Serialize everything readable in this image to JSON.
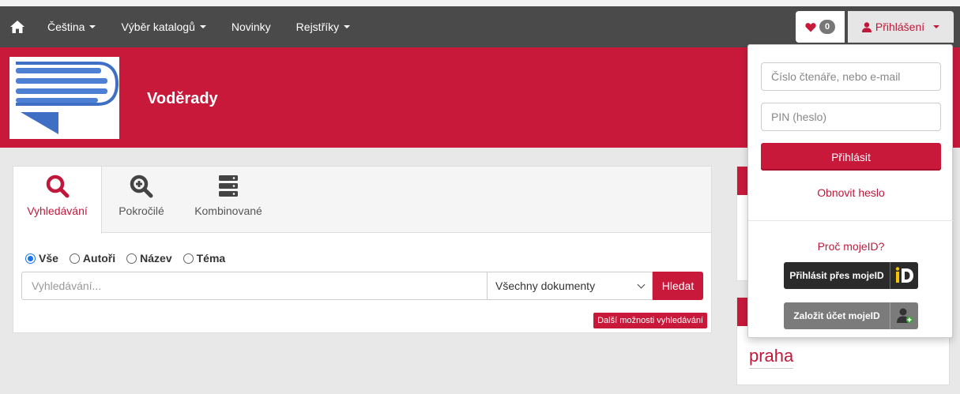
{
  "navbar": {
    "items": [
      {
        "label": "Čeština",
        "dropdown": true
      },
      {
        "label": "Výběr katalogů",
        "dropdown": true
      },
      {
        "label": "Novinky",
        "dropdown": false
      },
      {
        "label": "Rejstříky",
        "dropdown": true
      }
    ],
    "favorites_count": "0",
    "login_label": "Přihlášení"
  },
  "header": {
    "title": "Voděrady"
  },
  "search": {
    "tabs": [
      {
        "label": "Vyhledávání",
        "icon": "search-icon"
      },
      {
        "label": "Pokročilé",
        "icon": "zoom-in-icon"
      },
      {
        "label": "Kombinované",
        "icon": "server-stack-icon"
      }
    ],
    "radios": [
      "Vše",
      "Autoři",
      "Název",
      "Téma"
    ],
    "selected_radio": "Vše",
    "input_placeholder": "Vyhledávání...",
    "doc_type_selected": "Všechny dokumenty",
    "search_button": "Hledat",
    "more_options": "Další možnosti vyhledávání"
  },
  "side": {
    "tag_word": "praha"
  },
  "login_dropdown": {
    "reader_placeholder": "Číslo čtenáře, nebo e-mail",
    "pin_placeholder": "PIN (heslo)",
    "login_button": "Přihlásit",
    "reset_link": "Obnovit heslo",
    "mojeid_why": "Proč mojeID?",
    "mojeid_login": "Přihlásit přes mojeID",
    "mojeid_create": "Založit účet mojeID"
  },
  "colors": {
    "brand_red": "#c8193b",
    "navbar": "#4a4a4a"
  }
}
